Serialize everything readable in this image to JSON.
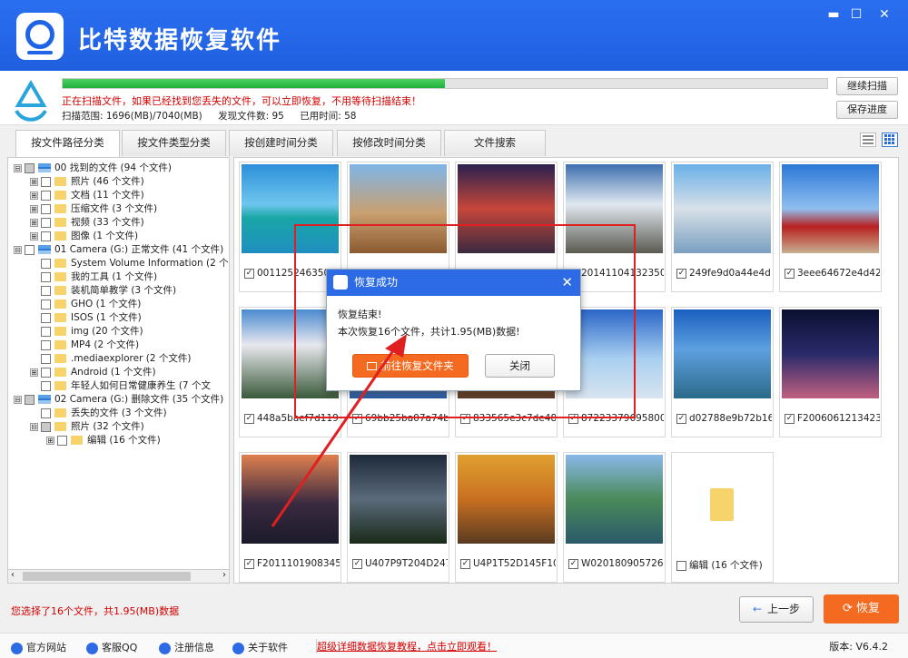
{
  "app": {
    "title": "比特数据恢复软件"
  },
  "window": {
    "minimize": "▬",
    "maximize": "☐",
    "close": "✕"
  },
  "scan": {
    "progress": 0.5,
    "message": "正在扫描文件，如果已经找到您丢失的文件，可以立即恢复，不用等待扫描结束！",
    "range": "扫描范围: 1696(MB)/7040(MB)",
    "found": "发现文件数: 95",
    "elapsed": "已用时间: 58",
    "continue_label": "继续扫描",
    "save_label": "保存进度"
  },
  "tabs": [
    "按文件路径分类",
    "按文件类型分类",
    "按创建时间分类",
    "按修改时间分类",
    "文件搜索"
  ],
  "tree": [
    {
      "label": "00 找到的文件 (94 个文件)",
      "toggle": "⊟",
      "drive": true
    },
    {
      "label": "照片  (46 个文件)",
      "toggle": "⊞"
    },
    {
      "label": "文档  (11 个文件)",
      "toggle": "⊞"
    },
    {
      "label": "压缩文件  (3 个文件)",
      "toggle": "⊞"
    },
    {
      "label": "视频  (33 个文件)",
      "toggle": "⊞"
    },
    {
      "label": "图像  (1 个文件)",
      "toggle": "⊞"
    },
    {
      "label": "01 Camera (G:) 正常文件 (41 个文件)",
      "toggle": "⊟",
      "drive": true
    },
    {
      "label": "System Volume Information  (2 个文",
      "toggle": ""
    },
    {
      "label": "我的工具  (1 个文件)",
      "toggle": ""
    },
    {
      "label": "装机简单教学  (3 个文件)",
      "toggle": ""
    },
    {
      "label": "GHO  (1 个文件)",
      "toggle": ""
    },
    {
      "label": "ISOS  (1 个文件)",
      "toggle": ""
    },
    {
      "label": "img  (20 个文件)",
      "toggle": ""
    },
    {
      "label": "MP4  (2 个文件)",
      "toggle": ""
    },
    {
      "label": ".mediaexplorer  (2 个文件)",
      "toggle": ""
    },
    {
      "label": "Android  (1 个文件)",
      "toggle": "⊞"
    },
    {
      "label": "年轻人如何日常健康养生  (7 个文",
      "toggle": ""
    },
    {
      "label": "02 Camera (G:) 删除文件 (35 个文件)",
      "toggle": "⊟",
      "drive": true
    },
    {
      "label": "丢失的文件  (3 个文件)",
      "toggle": ""
    },
    {
      "label": "照片  (32 个文件)",
      "toggle": "⊟"
    },
    {
      "label": "编辑  (16 个文件)",
      "toggle": "⊞"
    }
  ],
  "files": [
    {
      "name": "00112524635086",
      "checked": "✓"
    },
    {
      "name": "",
      "checked": ""
    },
    {
      "name": "",
      "checked": ""
    },
    {
      "name": "20141104132350",
      "checked": "✓"
    },
    {
      "name": "249fe9d0a44e4d...",
      "checked": "✓"
    },
    {
      "name": "3eee64672e4d42...",
      "checked": "✓"
    },
    {
      "name": "448a5baef7d119...",
      "checked": "✓"
    },
    {
      "name": "69bb25ba07a74b...",
      "checked": "✓"
    },
    {
      "name": "833565e3c7de48...",
      "checked": "✓"
    },
    {
      "name": "87223379695800...",
      "checked": "✓"
    },
    {
      "name": "d02788e9b72b16...",
      "checked": "✓"
    },
    {
      "name": "F2006061213423...",
      "checked": "✓"
    },
    {
      "name": "F2011101908345...",
      "checked": "✓"
    },
    {
      "name": "U407P9T204D247...",
      "checked": "✓"
    },
    {
      "name": "U4P1T52D145F10...",
      "checked": "✓"
    },
    {
      "name": "W020180905726...",
      "checked": "✓"
    },
    {
      "name": "编辑  (16 个文件)",
      "checked": ""
    }
  ],
  "modal": {
    "title": "恢复成功",
    "line1": "恢复结束!",
    "line2": "本次恢复16个文件，共计1.95(MB)数据!",
    "open_label": "前往恢复文件夹",
    "close_label": "关闭",
    "x": "✕"
  },
  "footer": {
    "selection": "您选择了16个文件，共1.95(MB)数据",
    "back_label": "上一步",
    "recover_label": "恢复"
  },
  "status": {
    "website": "官方网站",
    "qq": "客服QQ",
    "register": "注册信息",
    "about": "关于软件",
    "tutorial": "超级详细数据恢复教程，点击立即观看！",
    "version": "版本: V6.4.2"
  }
}
